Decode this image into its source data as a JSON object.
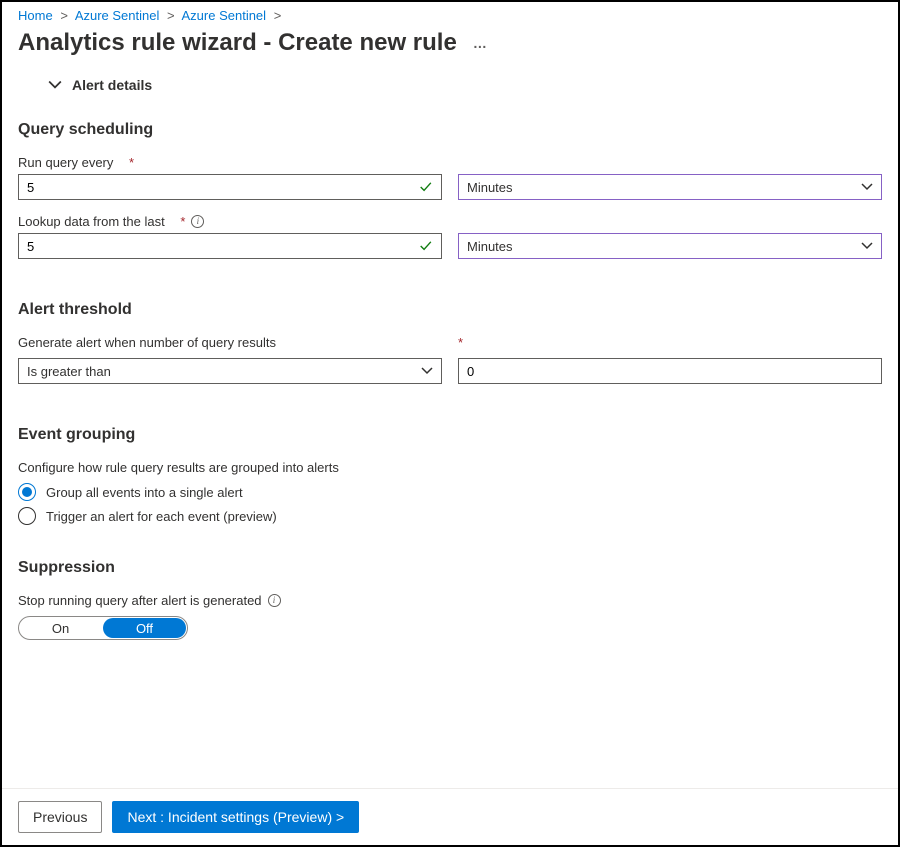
{
  "breadcrumb": {
    "home": "Home",
    "azsent1": "Azure Sentinel",
    "azsent2": "Azure Sentinel"
  },
  "title": "Analytics rule wizard - Create new rule",
  "alert_details": "Alert details",
  "query_scheduling": {
    "heading": "Query scheduling",
    "run_label": "Run query every",
    "run_value": "5",
    "run_unit": "Minutes",
    "lookup_label": "Lookup data from the last",
    "lookup_value": "5",
    "lookup_unit": "Minutes"
  },
  "alert_threshold": {
    "heading": "Alert threshold",
    "gen_label": "Generate alert when number of query results",
    "op": "Is greater than",
    "value": "0"
  },
  "event_grouping": {
    "heading": "Event grouping",
    "desc": "Configure how rule query results are grouped into alerts",
    "opt1": "Group all events into a single alert",
    "opt2": "Trigger an alert for each event (preview)"
  },
  "suppression": {
    "heading": "Suppression",
    "desc": "Stop running query after alert is generated",
    "on": "On",
    "off": "Off"
  },
  "footer": {
    "previous": "Previous",
    "next": "Next : Incident settings (Preview) >"
  }
}
